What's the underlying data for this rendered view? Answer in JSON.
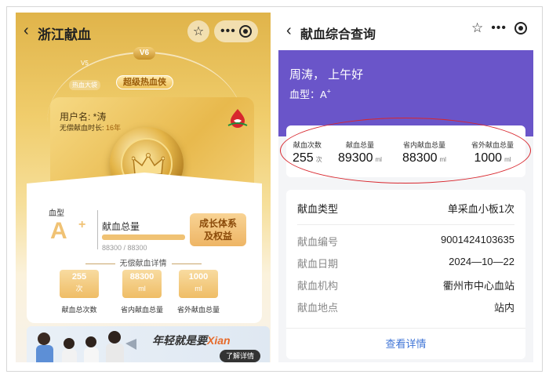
{
  "left": {
    "nav": {
      "back_icon": "chevron-left-icon",
      "title": "浙江献血"
    },
    "levels": {
      "current": "V6",
      "previous": "V5",
      "small_badge": "热血大袋",
      "main_badge": "超级热血侠"
    },
    "user": {
      "name_label": "用户名: *涛",
      "duration_prefix": "无偿献血时长: ",
      "duration_value": "16年"
    },
    "blood_type": {
      "label": "血型",
      "value": "A",
      "plus": "+"
    },
    "total": {
      "label": "献血总量",
      "value_text": "88300 / 88300",
      "progress": 1.0
    },
    "grow_button": {
      "line1": "成长体系",
      "line2": "及权益"
    },
    "details": {
      "title": "无偿献血详情",
      "items": [
        {
          "value": "255",
          "unit": "次",
          "label": "献血总次数"
        },
        {
          "value": "88300",
          "unit": "ml",
          "label": "省内献血总量"
        },
        {
          "value": "1000",
          "unit": "ml",
          "label": "省外献血总量"
        }
      ]
    },
    "banner": {
      "text_prefix": "年轻就是要",
      "text_highlight": "Xian",
      "button": "了解详情"
    }
  },
  "right": {
    "nav": {
      "back_icon": "chevron-left-icon",
      "title": "献血综合查询"
    },
    "greeting": "周涛，  上午好",
    "blood_type_label": "血型：A",
    "blood_type_sup": "+",
    "stats": [
      {
        "label": "献血次数",
        "value": "255",
        "unit": "次"
      },
      {
        "label": "献血总量",
        "value": "89300",
        "unit": "ml"
      },
      {
        "label": "省内献血总量",
        "value": "88300",
        "unit": "ml"
      },
      {
        "label": "省外献血总量",
        "value": "1000",
        "unit": "ml"
      }
    ],
    "record": {
      "type_label": "献血类型",
      "type_value": "单采血小板1次",
      "rows": [
        {
          "key": "献血编号",
          "value": "9001424103635"
        },
        {
          "key": "献血日期",
          "value": "2024—10—22"
        },
        {
          "key": "献血机构",
          "value": "衢州市中心血站"
        },
        {
          "key": "献血地点",
          "value": "站内"
        }
      ],
      "link": "查看详情"
    }
  },
  "colors": {
    "gold": "#f0c274",
    "purple": "#6a55c9",
    "link": "#3f74d6",
    "highlight_ellipse": "#d8262d"
  }
}
